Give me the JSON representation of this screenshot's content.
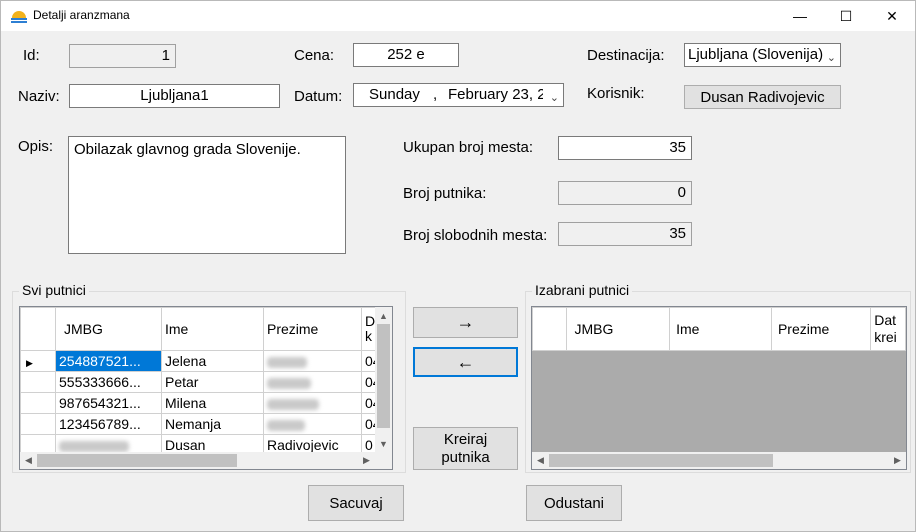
{
  "window": {
    "title": "Detalji aranzmana",
    "minimize": "—",
    "maximize": "☐",
    "close": "✕"
  },
  "form": {
    "id_label": "Id:",
    "id_value": "1",
    "naziv_label": "Naziv:",
    "naziv_value": "Ljubljana1",
    "opis_label": "Opis:",
    "opis_value": "Obilazak glavnog grada Slovenije.",
    "cena_label": "Cena:",
    "cena_value": "252 e",
    "datum_label": "Datum:",
    "datum_day": "Sunday",
    "datum_sep": ",",
    "datum_month_day": "February 23, 2",
    "destinacija_label": "Destinacija:",
    "destinacija_value": "Ljubljana (Slovenija)",
    "korisnik_label": "Korisnik:",
    "korisnik_value": "Dusan Radivojevic",
    "ukupan_label": "Ukupan broj mesta:",
    "ukupan_value": "35",
    "broj_putnika_label": "Broj putnika:",
    "broj_putnika_value": "0",
    "slobodnih_label": "Broj slobodnih mesta:",
    "slobodnih_value": "35"
  },
  "svi_putnici": {
    "title": "Svi putnici",
    "columns": [
      "JMBG",
      "Ime",
      "Prezime",
      "D k"
    ],
    "rows": [
      {
        "jmbg": "254887521...",
        "ime": "Jelena",
        "dat": "04",
        "selected": true
      },
      {
        "jmbg": "555333666...",
        "ime": "Petar",
        "dat": "04"
      },
      {
        "jmbg": "987654321...",
        "ime": "Milena",
        "dat": "04"
      },
      {
        "jmbg": "123456789...",
        "ime": "Nemanja",
        "dat": "04"
      },
      {
        "jmbg": "",
        "ime": "Dusan",
        "prezime": "Radivojevic",
        "dat": "0"
      }
    ]
  },
  "izabrani_putnici": {
    "title": "Izabrani putnici",
    "columns": [
      "JMBG",
      "Ime",
      "Prezime",
      "Dat krei"
    ]
  },
  "buttons": {
    "add": "→",
    "remove": "←",
    "kreiraj_line1": "Kreiraj",
    "kreiraj_line2": "putnika",
    "sacuvaj": "Sacuvaj",
    "odustani": "Odustani"
  }
}
